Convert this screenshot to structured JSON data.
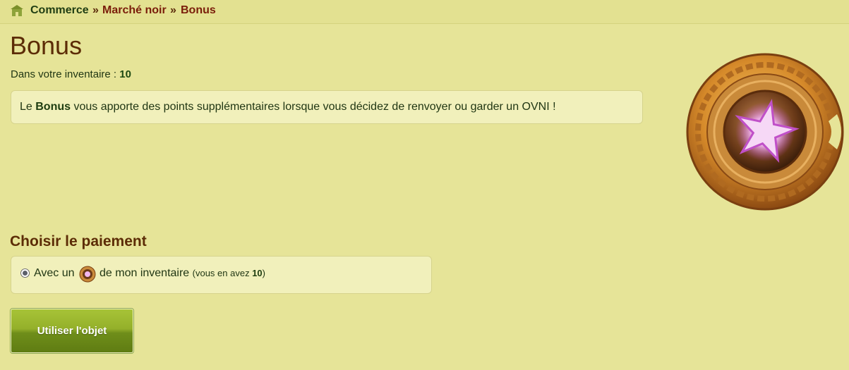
{
  "breadcrumb": {
    "items": [
      "Commerce",
      "Marché noir",
      "Bonus"
    ],
    "separator": "»"
  },
  "page": {
    "title": "Bonus",
    "inventory_label": "Dans votre inventaire : ",
    "inventory_count": "10"
  },
  "description": {
    "prefix": "Le ",
    "item_name": "Bonus",
    "suffix": " vous apporte des points supplémentaires lorsque vous décidez de renvoyer ou garder un OVNI !"
  },
  "payment": {
    "section_title": "Choisir le paiement",
    "option_prefix": "Avec un",
    "option_suffix": "de mon inventaire",
    "note_prefix": "(vous en avez ",
    "note_count": "10",
    "note_suffix": ")"
  },
  "actions": {
    "use_label": "Utiliser l'objet"
  },
  "icons": {
    "home": "home-icon",
    "medal": "bonus-medal-icon",
    "mini_medal": "bonus-medal-small-icon"
  },
  "colors": {
    "background": "#e6e498",
    "title": "#5c2c06",
    "crumb_active": "#7a1d0a",
    "button": "#7a9a20"
  }
}
